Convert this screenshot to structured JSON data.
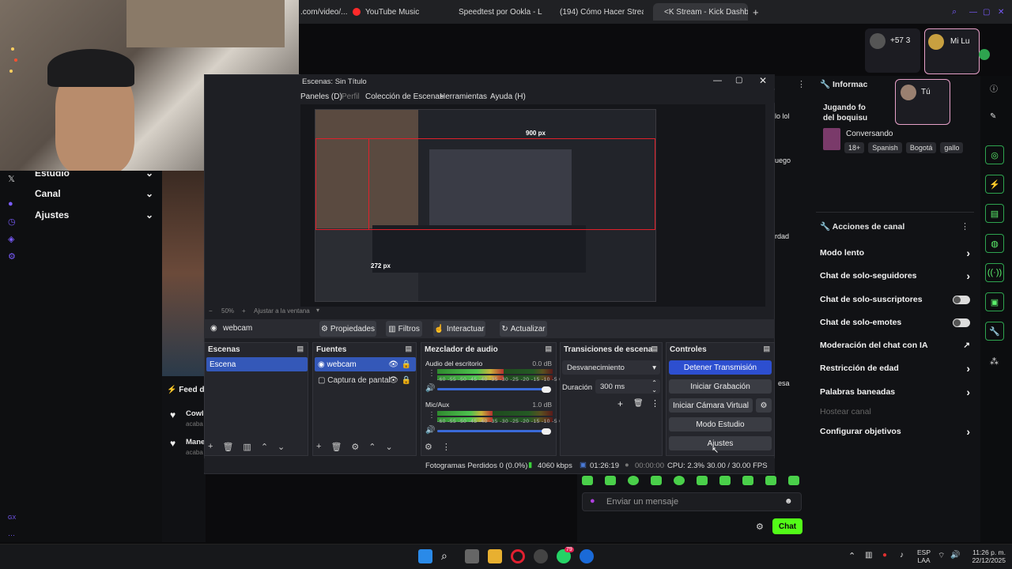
{
  "browser": {
    "tabs": [
      {
        "label": ".com/video/..."
      },
      {
        "label": "YouTube Music"
      },
      {
        "label": "Speedtest por Ookla - La"
      },
      {
        "label": "(194) Cómo Hacer Strean"
      },
      {
        "label": "<K Stream - Kick Dashbo"
      }
    ],
    "new_tab": "+"
  },
  "left_sidebar": {
    "items": [
      {
        "label": "Estudio"
      },
      {
        "label": "Canal"
      },
      {
        "label": "Ajustes"
      }
    ]
  },
  "obs": {
    "title": "Escenas: Sin Título",
    "menu": [
      {
        "label": "Paneles (D)",
        "dim": false
      },
      {
        "label": "Perfil",
        "dim": true
      },
      {
        "label": "Colección de Escenas",
        "dim": false
      },
      {
        "label": "Herramientas",
        "dim": false
      },
      {
        "label": "Ayuda (H)",
        "dim": false
      }
    ],
    "preview": {
      "label_top": "900 px",
      "label_bottom": "272 px"
    },
    "zoom": {
      "percent": "50%",
      "fit": "Ajustar a la ventana"
    },
    "source_bar": {
      "source": "webcam",
      "buttons": [
        "Propiedades",
        "Filtros",
        "Interactuar",
        "Actualizar"
      ]
    },
    "scenes": {
      "title": "Escenas",
      "items": [
        "Escena"
      ]
    },
    "sources": {
      "title": "Fuentes",
      "items": [
        "webcam",
        "Captura de pantal"
      ]
    },
    "mixer": {
      "title": "Mezclador de audio",
      "channels": [
        {
          "name": "Audio del escritorio",
          "db": "0.0 dB"
        },
        {
          "name": "Mic/Aux",
          "db": "1.0 dB"
        }
      ],
      "scale": "-60 -55 -50 -45 -40 -35 -30 -25 -20 -15 -10 -5  0"
    },
    "transitions": {
      "title": "Transiciones de escena",
      "selected": "Desvanecimiento",
      "duration_label": "Duración",
      "duration_value": "300 ms"
    },
    "controls": {
      "title": "Controles",
      "buttons": [
        "Detener Transmisión",
        "Iniciar Grabación",
        "Iniciar Cámara Virtual",
        "Modo Estudio",
        "Ajustes"
      ]
    },
    "status": {
      "dropped": "Fotogramas Perdidos 0 (0.0%)",
      "bitrate": "4060 kbps",
      "stream_time": "01:26:19",
      "rec_time": "00:00:00",
      "cpu": "CPU: 2.3%",
      "fps": "30.00 / 30.00 FPS"
    }
  },
  "stream_info": {
    "heading": "Informac",
    "title_line1": "Jugando fo",
    "title_line2": "del boquisu",
    "category": "Conversando",
    "tags": [
      "18+",
      "Spanish",
      "Bogotá",
      "gallo"
    ],
    "snippets": [
      "lo lol",
      "uego",
      "rdad",
      "esa"
    ]
  },
  "channel_actions": {
    "title": "Acciones de canal",
    "items": [
      {
        "label": "Modo lento",
        "control": "arrow"
      },
      {
        "label": "Chat de solo-seguidores",
        "control": "arrow"
      },
      {
        "label": "Chat de solo-suscriptores",
        "control": "toggle"
      },
      {
        "label": "Chat de solo-emotes",
        "control": "toggle"
      },
      {
        "label": "Moderación del chat con IA",
        "control": "external"
      },
      {
        "label": "Restricción de edad",
        "control": "arrow"
      },
      {
        "label": "Palabras baneadas",
        "control": "arrow"
      },
      {
        "label": "Hostear canal",
        "control": "none"
      },
      {
        "label": "Configurar objetivos",
        "control": "arrow"
      }
    ]
  },
  "feed": {
    "title": "Feed de",
    "items": [
      {
        "name": "Cowl",
        "sub": "acaba"
      },
      {
        "name": "Mane",
        "sub": "acaba"
      }
    ]
  },
  "call": {
    "others_count": "+57 3",
    "tile_main": "Mi Lu",
    "tile_self": "Tú"
  },
  "chat": {
    "placeholder": "Enviar un mensaje",
    "send_label": "Chat"
  },
  "taskbar": {
    "lang_top": "ESP",
    "lang_bottom": "LAA",
    "time": "11:26 p. m.",
    "date": "22/12/2025",
    "badge": "79"
  },
  "colors": {
    "kick_green": "#53fc18",
    "obs_blue": "#2d4fd0",
    "accent_purple": "#7a5cff"
  }
}
